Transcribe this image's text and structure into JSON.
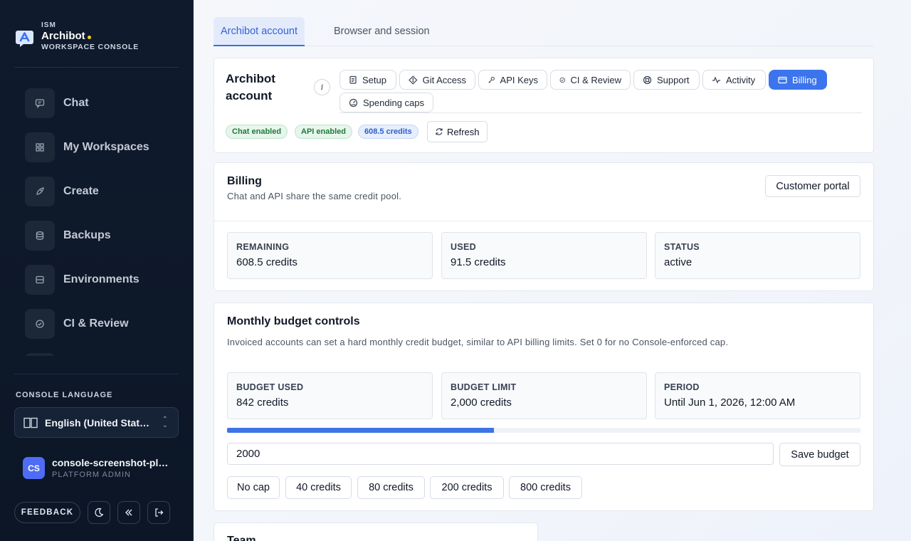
{
  "brand": {
    "org": "ISM",
    "name": "Archibot",
    "subtitle": "WORKSPACE CONSOLE"
  },
  "sidebar": {
    "items": [
      {
        "label": "Chat",
        "icon": "chat-icon"
      },
      {
        "label": "My Workspaces",
        "icon": "grid-icon"
      },
      {
        "label": "Create",
        "icon": "rocket-icon"
      },
      {
        "label": "Backups",
        "icon": "database-icon"
      },
      {
        "label": "Environments",
        "icon": "server-icon"
      },
      {
        "label": "CI & Review",
        "icon": "check-circle-icon"
      }
    ],
    "language_label": "CONSOLE LANGUAGE",
    "language_value": "English (United States)",
    "user": {
      "initials": "CS",
      "name": "console-screenshot-platform-admin",
      "role": "PLATFORM ADMIN"
    },
    "feedback_label": "FEEDBACK"
  },
  "tabs": [
    {
      "label": "Archibot account",
      "active": true
    },
    {
      "label": "Browser and session",
      "active": false
    }
  ],
  "account": {
    "title": "Archibot account",
    "info_label": "i",
    "pills": [
      {
        "label": "Setup",
        "icon": "clipboard-icon"
      },
      {
        "label": "Git Access",
        "icon": "git-icon"
      },
      {
        "label": "API Keys",
        "icon": "key-icon"
      },
      {
        "label": "CI & Review",
        "icon": "check-circle-icon"
      },
      {
        "label": "Support",
        "icon": "lifebuoy-icon"
      },
      {
        "label": "Activity",
        "icon": "activity-icon"
      },
      {
        "label": "Billing",
        "icon": "credit-card-icon",
        "active": true
      },
      {
        "label": "Spending caps",
        "icon": "gauge-icon"
      }
    ],
    "badges": {
      "chat": "Chat enabled",
      "api": "API enabled",
      "credits": "608.5 credits"
    },
    "refresh_label": "Refresh"
  },
  "billing": {
    "title": "Billing",
    "subtitle": "Chat and API share the same credit pool.",
    "portal_label": "Customer portal",
    "stats": [
      {
        "label": "REMAINING",
        "value": "608.5 credits"
      },
      {
        "label": "USED",
        "value": "91.5 credits"
      },
      {
        "label": "STATUS",
        "value": "active"
      }
    ]
  },
  "budget": {
    "title": "Monthly budget controls",
    "subtitle": "Invoiced accounts can set a hard monthly credit budget, similar to API billing limits. Set 0 for no Console-enforced cap.",
    "stats": [
      {
        "label": "BUDGET USED",
        "value": "842 credits"
      },
      {
        "label": "BUDGET LIMIT",
        "value": "2,000 credits"
      },
      {
        "label": "PERIOD",
        "value": "Until Jun 1, 2026, 12:00 AM"
      }
    ],
    "progress_fraction": 0.421,
    "input_value": "2000",
    "save_label": "Save budget",
    "presets": [
      "No cap",
      "40 credits",
      "80 credits",
      "200 credits",
      "800 credits"
    ]
  },
  "team": {
    "title": "Team"
  },
  "colors": {
    "accent": "#3b74ec",
    "sidebar_bg": "#0f1b2d",
    "progress": "#3d74e6"
  }
}
